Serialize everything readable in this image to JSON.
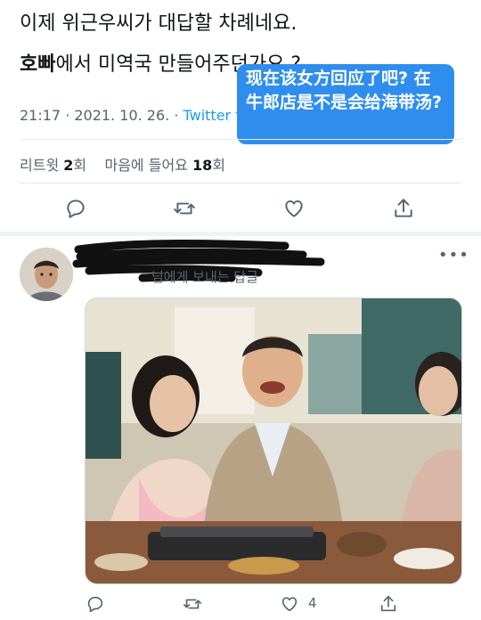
{
  "tweet": {
    "line1": "이제 위근우씨가 대답할 차례네요.",
    "line2_bold": "호빠",
    "line2_rest": "에서 미역국 만들어주던가요 ?",
    "time": "21:17 · 2021. 10. 26. · ",
    "source": "Twitter for iPhone"
  },
  "stats": {
    "retweet_label": "리트윗",
    "retweet_count": "2",
    "retweet_unit": "회",
    "like_label": "마음에 들어요",
    "like_count": "18",
    "like_unit": "회"
  },
  "overlay": {
    "text": "现在该女方回应了吧? 在牛郎店是不是会给海带汤?"
  },
  "reply": {
    "reply_to": "님에게 보내는 답글",
    "like_count": "4"
  },
  "colors": {
    "accent": "#1d9bf0",
    "overlay_bg": "#2f8eed",
    "secondary_text": "#536471"
  },
  "icons": [
    "reply-icon",
    "retweet-icon",
    "heart-icon",
    "share-icon",
    "more-icon"
  ]
}
